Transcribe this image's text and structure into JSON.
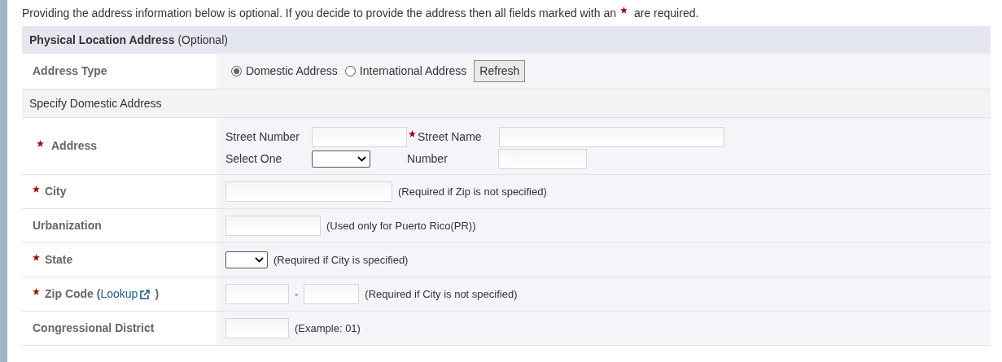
{
  "intro": {
    "before": "Providing the address information below is optional. If you decide to provide the address then all fields marked with an",
    "after": "are required."
  },
  "section": {
    "title": "Physical Location Address",
    "note": "(Optional)"
  },
  "address_type": {
    "label": "Address Type",
    "options": [
      {
        "label": "Domestic Address",
        "selected": true
      },
      {
        "label": "International Address",
        "selected": false
      }
    ],
    "button": "Refresh"
  },
  "subsection": "Specify Domestic Address",
  "address": {
    "label": "Address",
    "required": true,
    "street_number": "Street Number",
    "street_name": "Street Name",
    "street_name_required": true,
    "select_one": "Select One",
    "number": "Number"
  },
  "rows": [
    {
      "label": "City",
      "required": true,
      "controls": [
        {
          "kind": "text"
        },
        {
          "kind": "hint",
          "text": "(Required if Zip is not specified)"
        }
      ]
    },
    {
      "label": "Urbanization",
      "required": false,
      "controls": [
        {
          "kind": "text"
        },
        {
          "kind": "hint",
          "text": "(Used only for Puerto Rico(PR))"
        }
      ]
    },
    {
      "label": "State",
      "required": true,
      "controls": [
        {
          "kind": "select"
        },
        {
          "kind": "hint",
          "text": "(Required if City is specified)"
        }
      ]
    },
    {
      "label": "Zip Code (",
      "link": "Lookup",
      "label_end": ")",
      "required": true,
      "controls": [
        {
          "kind": "text"
        },
        {
          "kind": "hint",
          "text": "-"
        },
        {
          "kind": "text"
        },
        {
          "kind": "hint",
          "text": "(Required if City is not specified)"
        }
      ]
    },
    {
      "label": "Congressional District",
      "required": false,
      "controls": [
        {
          "kind": "text"
        },
        {
          "kind": "hint",
          "text": "(Example: 01)"
        }
      ]
    }
  ]
}
